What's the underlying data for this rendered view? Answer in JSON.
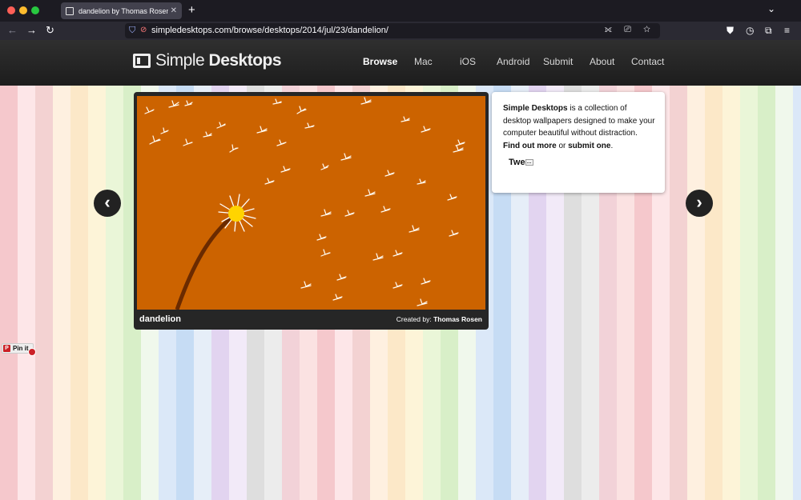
{
  "browser": {
    "tab_title": "dandelion by Thomas Rosen — Si",
    "tab_close": "✕",
    "new_tab": "+",
    "tabs_menu": "⌄",
    "url": "simpledesktops.com/browse/desktops/2014/jul/23/dandelion/",
    "back": "←",
    "forward": "→",
    "reload": "↻",
    "url_shield": "⛉",
    "url_lock": "⊘",
    "url_icons": "⟗ ⎚ ☆",
    "toolbar_pocket": "⛊",
    "toolbar_history": "◷",
    "toolbar_extensions": "⧉",
    "toolbar_menu": "≡"
  },
  "site": {
    "logo_light": "Simple ",
    "logo_bold": "Desktops",
    "nav": [
      "Browse",
      "Mac",
      "iOS",
      "Android",
      "Submit",
      "About",
      "Contact"
    ],
    "active_nav": "Browse"
  },
  "wallpaper": {
    "title": "dandelion",
    "credit_label": "Created by: ",
    "author": "Thomas Rosen",
    "background_color": "#cc6300"
  },
  "info": {
    "brand": "Simple Desktops",
    "text": " is a collection of desktop wallpapers designed to make your computer beautiful without distraction. ",
    "find_out_more": "Find out more",
    "or": " or ",
    "submit_one": "submit one",
    "period": ".",
    "tweet": "Twe",
    "tweet_badge": "…"
  },
  "navigation": {
    "prev_icon": "‹",
    "next_icon": "›"
  },
  "pinit": {
    "logo": "P",
    "label": "Pin it"
  }
}
